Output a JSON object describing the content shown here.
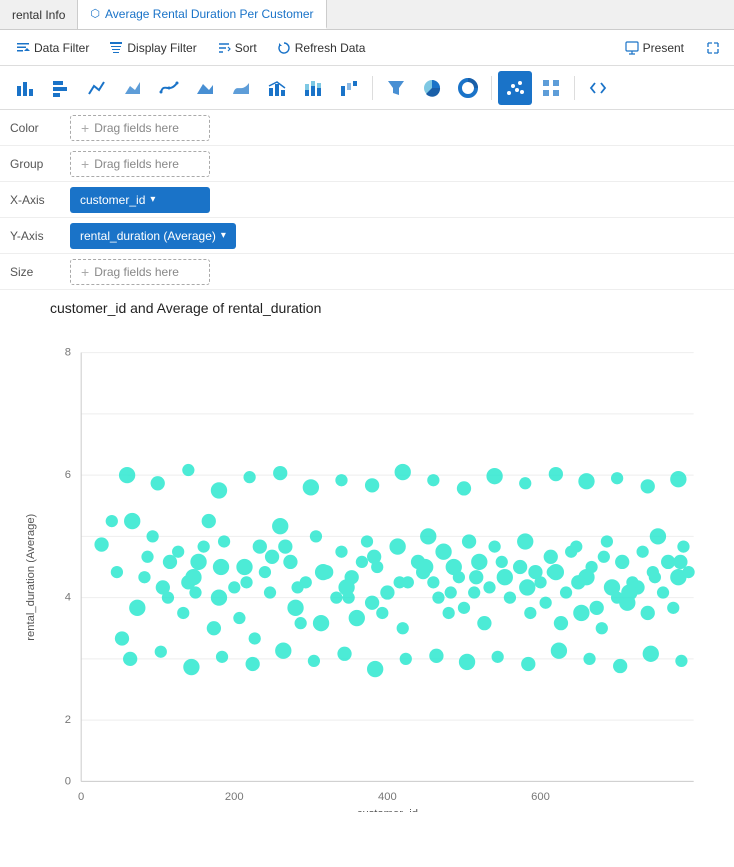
{
  "tabs": [
    {
      "id": "rental-info",
      "label": "rental Info",
      "active": false
    },
    {
      "id": "avg-rental",
      "label": "Average Rental Duration Per Customer",
      "active": true
    }
  ],
  "toolbar": {
    "data_filter": "Data Filter",
    "display_filter": "Display Filter",
    "sort": "Sort",
    "refresh_data": "Refresh Data",
    "present": "Present"
  },
  "fields": {
    "color_label": "Color",
    "group_label": "Group",
    "x_axis_label": "X-Axis",
    "y_axis_label": "Y-Axis",
    "size_label": "Size",
    "drag_placeholder": "Drag fields here",
    "x_axis_value": "customer_id",
    "y_axis_value": "rental_duration (Average)"
  },
  "chart": {
    "title": "customer_id and Average of rental_duration",
    "x_axis_title": "customer_id",
    "y_axis_title": "rental_duration (Average)",
    "x_min": 0,
    "x_max": 600,
    "y_min": 0,
    "y_max": 8,
    "color": "#2de8d0"
  },
  "icons": {
    "bar_chart": "▋",
    "bar_chart2": "▐",
    "line": "⟋",
    "area": "◿",
    "scatter": "⠿",
    "code": "◫"
  }
}
